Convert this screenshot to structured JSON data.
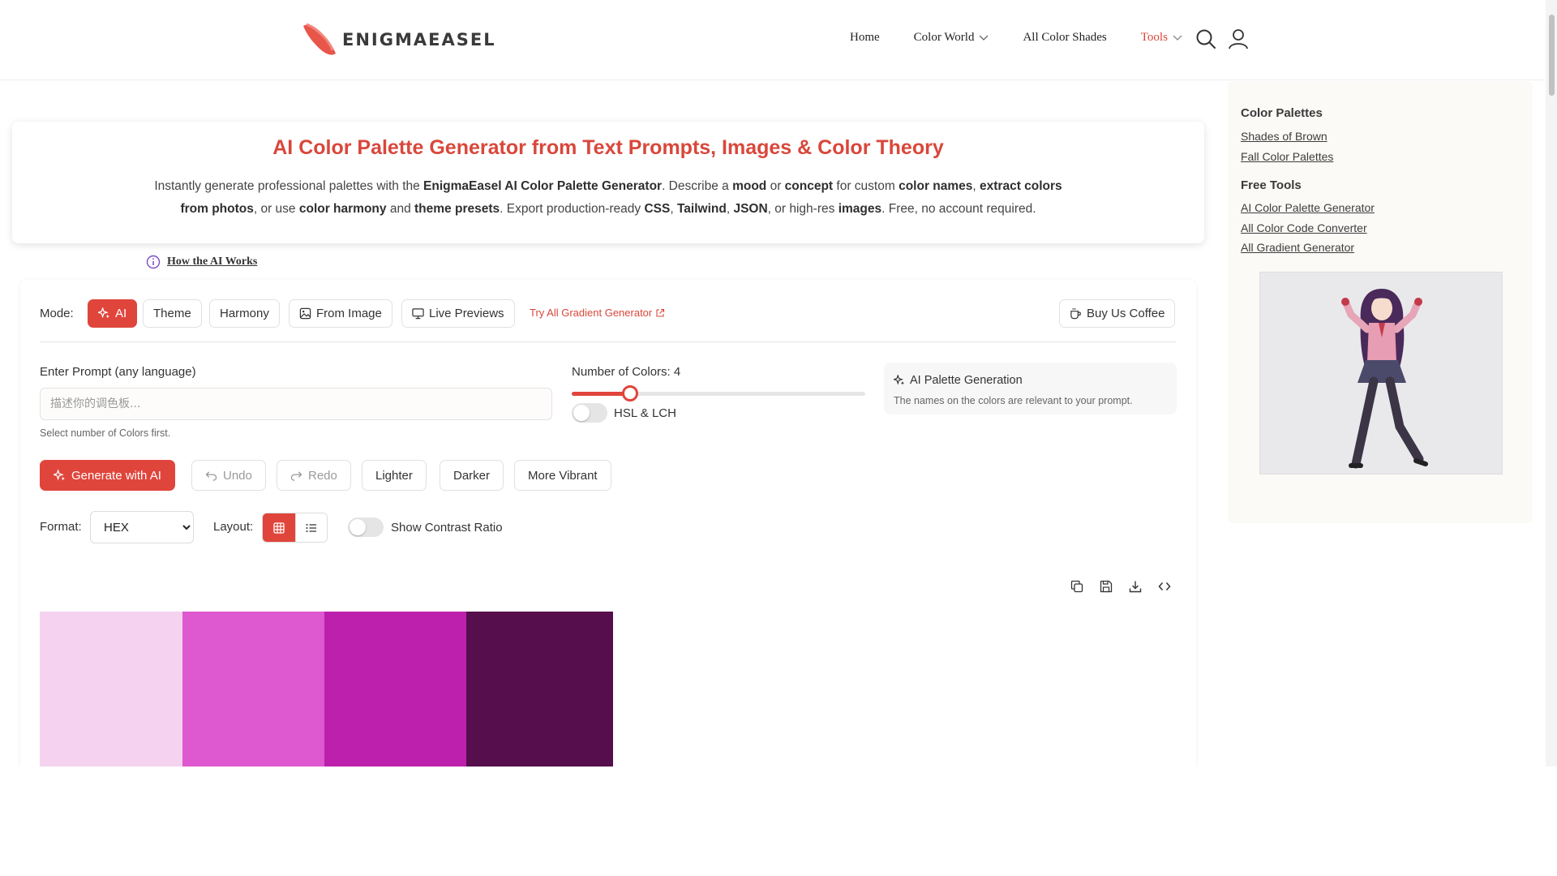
{
  "header": {
    "logo_text": "ENIGMAEASEL",
    "nav": {
      "home": "Home",
      "color_world": "Color World",
      "all_color_shades": "All Color Shades",
      "tools": "Tools"
    },
    "icons": [
      "search-icon",
      "user-icon"
    ]
  },
  "hero": {
    "title": "AI Color Palette Generator from Text Prompts, Images & Color Theory",
    "intro": {
      "t1": "Instantly generate professional palettes with the ",
      "b1": "EnigmaEasel AI Color Palette Generator",
      "t2": ". Describe a ",
      "b2": "mood",
      "t3": " or ",
      "b3": "concept",
      "t4": " for custom ",
      "b4": "color names",
      "t5": ", ",
      "b5": "extract colors from photos",
      "t6": ", or use ",
      "b6": "color harmony",
      "t7": " and ",
      "b7": "theme presets",
      "t8": ". Export production-ready ",
      "b8": "CSS",
      "t9": ", ",
      "b9": "Tailwind",
      "t10": ", ",
      "b10": "JSON",
      "t11": ", or high-res ",
      "b11": "images",
      "t12": ". Free, no account required."
    }
  },
  "how_ai_works": "How the AI Works",
  "mode": {
    "label": "Mode:",
    "ai": "AI",
    "theme": "Theme",
    "harmony": "Harmony",
    "from_image": "From Image",
    "live_previews": "Live Previews",
    "gradient_link": "Try All Gradient Generator",
    "buy_coffee": "Buy Us Coffee"
  },
  "prompt": {
    "label": "Enter Prompt (any language)",
    "placeholder": "描述你的调色板...",
    "value": "",
    "hint": "Select number of Colors first."
  },
  "colors": {
    "label": "Number of Colors: 4",
    "count": 4,
    "min": 2,
    "max": 12,
    "hsl_lch_label": "HSL & LCH"
  },
  "ai_info": {
    "title": "AI Palette Generation",
    "desc": "The names on the colors are relevant to your prompt."
  },
  "actions": {
    "generate": "Generate with AI",
    "undo": "Undo",
    "redo": "Redo",
    "lighter": "Lighter",
    "darker": "Darker",
    "vibrant": "More Vibrant"
  },
  "format": {
    "label": "Format:",
    "selected": "HEX"
  },
  "layout": {
    "label": "Layout:",
    "active": "grid"
  },
  "contrast": {
    "label": "Show Contrast Ratio"
  },
  "palette": [
    {
      "color": "#f5d3f0"
    },
    {
      "color": "#de58cf"
    },
    {
      "color": "#bd20ad"
    },
    {
      "color": "#560e4c"
    }
  ],
  "sidebar": {
    "palettes_heading": "Color Palettes",
    "palette_links": [
      "Shades of Brown",
      "Fall Color Palettes"
    ],
    "tools_heading": "Free Tools",
    "tool_links": [
      "AI Color Palette Generator",
      "All Color Code Converter",
      "All Gradient Generator"
    ]
  },
  "accent_color": "#e0453c"
}
